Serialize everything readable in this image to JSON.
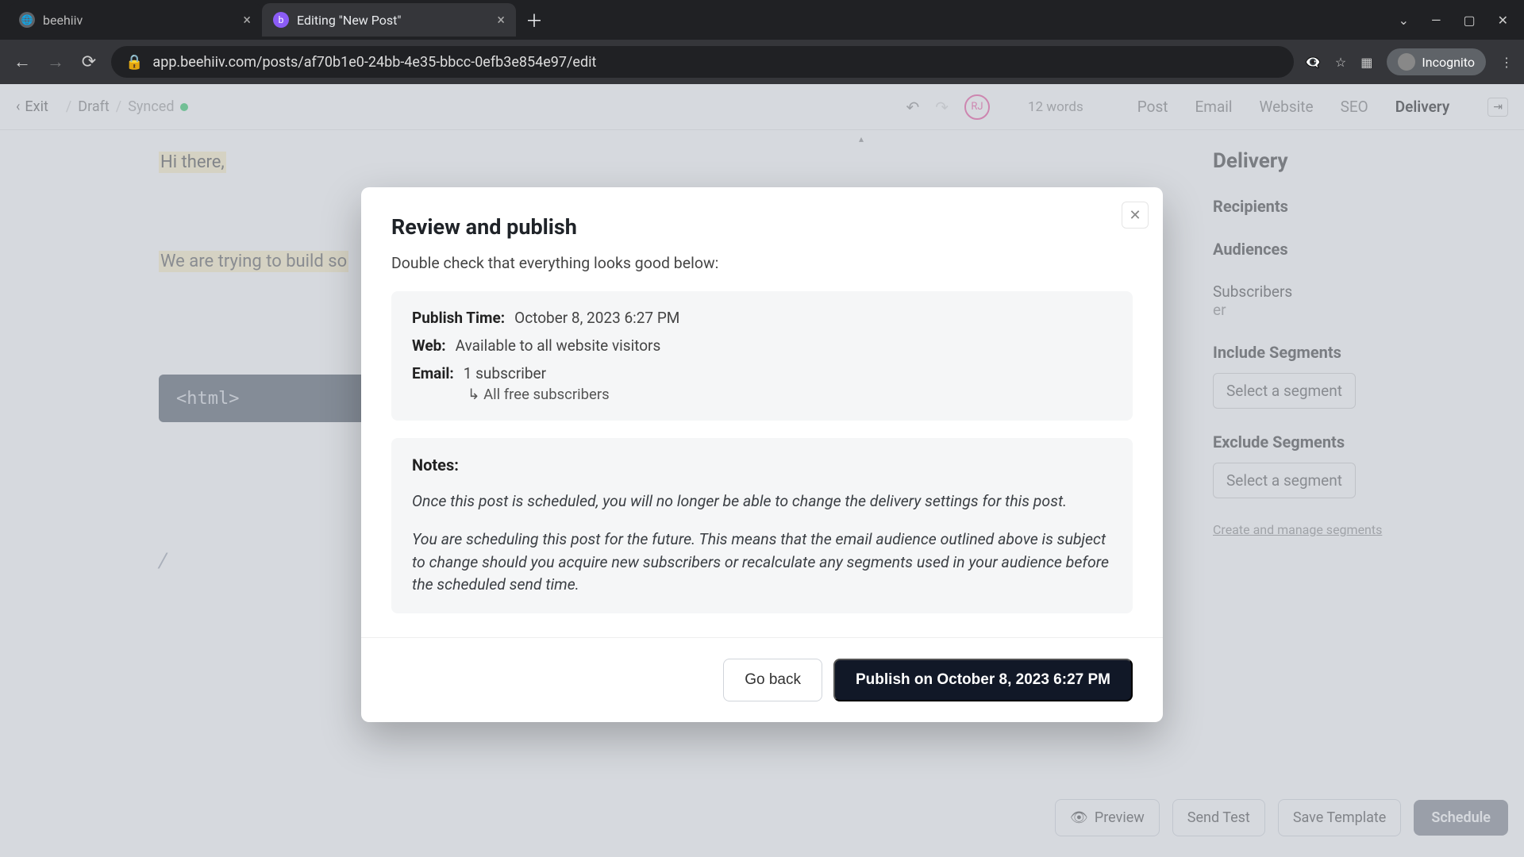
{
  "browser": {
    "tabs": [
      {
        "title": "beehiiv"
      },
      {
        "title": "Editing \"New Post\""
      }
    ],
    "url": "app.beehiiv.com/posts/af70b1e0-24bb-4e35-bbcc-0efb3e854e97/edit",
    "incognito_label": "Incognito"
  },
  "header": {
    "exit": "Exit",
    "draft": "Draft",
    "synced": "Synced",
    "avatar_initials": "RJ",
    "word_count": "12 words",
    "tabs": {
      "post": "Post",
      "email": "Email",
      "website": "Website",
      "seo": "SEO",
      "delivery": "Delivery"
    }
  },
  "editor": {
    "line1": "Hi there,",
    "line2": "We are trying to build so",
    "code": "<html>",
    "slash": "/"
  },
  "rail": {
    "title": "Delivery",
    "recipients": "Recipients",
    "audiences": "Audiences",
    "subscribers": "Subscribers",
    "sub_count_suffix": "er",
    "include_title": "Include Segments",
    "include_pill": "Select a segment",
    "exclude_title": "Exclude Segments",
    "exclude_pill": "Select a segment",
    "manage": "Create and manage segments",
    "preview": "Preview",
    "send_test": "Send Test",
    "save_template": "Save Template",
    "schedule": "Schedule"
  },
  "modal": {
    "title": "Review and publish",
    "subtitle": "Double check that everything looks good below:",
    "publish_label": "Publish Time:",
    "publish_value": "October 8, 2023 6:27 PM",
    "web_label": "Web:",
    "web_value": "Available to all website visitors",
    "email_label": "Email:",
    "email_value": "1 subscriber",
    "email_detail_prefix": "↳  ",
    "email_detail": "All free subscribers",
    "notes_title": "Notes:",
    "note1": "Once this post is scheduled, you will no longer be able to change the delivery settings for this post.",
    "note2": "You are scheduling this post for the future. This means that the email audience outlined above is subject to change should you acquire new subscribers or recalculate any segments used in your audience before the scheduled send time.",
    "go_back": "Go back",
    "publish_button": "Publish on October 8, 2023 6:27 PM"
  }
}
